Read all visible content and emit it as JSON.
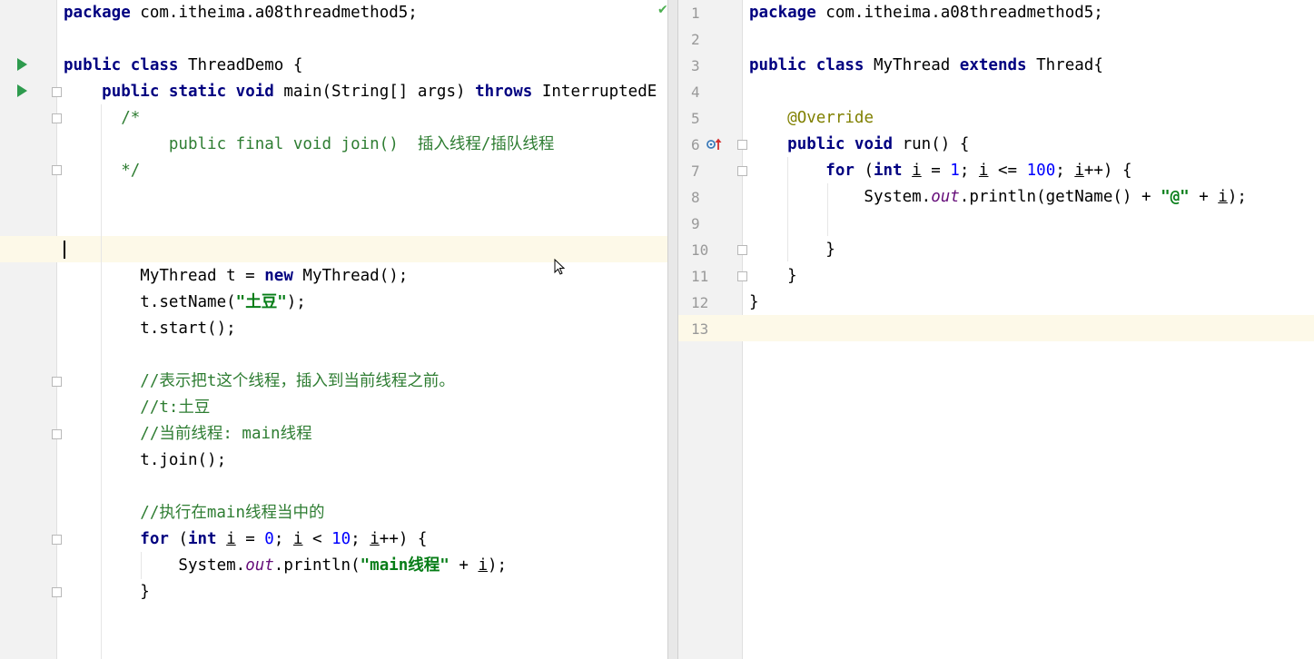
{
  "left_editor": {
    "lines": [
      {
        "parts": [
          {
            "t": "package",
            "c": "kw"
          },
          {
            "t": " com.itheima.a08threadmethod5;"
          }
        ]
      },
      {
        "parts": []
      },
      {
        "parts": [
          {
            "t": "public class",
            "c": "kw"
          },
          {
            "t": " ThreadDemo {"
          }
        ]
      },
      {
        "parts": [
          {
            "t": "    "
          },
          {
            "t": "public static void",
            "c": "kw"
          },
          {
            "t": " main(String[] args) "
          },
          {
            "t": "throws",
            "c": "kw"
          },
          {
            "t": " InterruptedE"
          }
        ]
      },
      {
        "parts": [
          {
            "t": "      /*",
            "c": "cmt"
          }
        ]
      },
      {
        "parts": [
          {
            "t": "           public final void join()  插入线程/插队线程",
            "c": "cmt"
          }
        ]
      },
      {
        "parts": [
          {
            "t": "      */",
            "c": "cmt"
          }
        ]
      },
      {
        "parts": []
      },
      {
        "parts": []
      },
      {
        "parts": []
      },
      {
        "parts": [
          {
            "t": "        MyThread t = "
          },
          {
            "t": "new",
            "c": "kw"
          },
          {
            "t": " MyThread();"
          }
        ]
      },
      {
        "parts": [
          {
            "t": "        t.setName("
          },
          {
            "t": "\"土豆\"",
            "c": "str"
          },
          {
            "t": ");"
          }
        ]
      },
      {
        "parts": [
          {
            "t": "        t.start();"
          }
        ]
      },
      {
        "parts": []
      },
      {
        "parts": [
          {
            "t": "        //表示把t这个线程，插入到当前线程之前。",
            "c": "cmt"
          }
        ]
      },
      {
        "parts": [
          {
            "t": "        //t:土豆",
            "c": "cmt"
          }
        ]
      },
      {
        "parts": [
          {
            "t": "        //当前线程: main线程",
            "c": "cmt"
          }
        ]
      },
      {
        "parts": [
          {
            "t": "        t.join();"
          }
        ]
      },
      {
        "parts": []
      },
      {
        "parts": [
          {
            "t": "        //执行在main线程当中的",
            "c": "cmt"
          }
        ]
      },
      {
        "parts": [
          {
            "t": "        "
          },
          {
            "t": "for",
            "c": "kw"
          },
          {
            "t": " ("
          },
          {
            "t": "int",
            "c": "kw"
          },
          {
            "t": " "
          },
          {
            "t": "i",
            "c": "ul"
          },
          {
            "t": " = "
          },
          {
            "t": "0",
            "c": "num"
          },
          {
            "t": "; "
          },
          {
            "t": "i",
            "c": "ul"
          },
          {
            "t": " < "
          },
          {
            "t": "10",
            "c": "num"
          },
          {
            "t": "; "
          },
          {
            "t": "i",
            "c": "ul"
          },
          {
            "t": "++) {"
          }
        ]
      },
      {
        "parts": [
          {
            "t": "            System."
          },
          {
            "t": "out",
            "c": "stat"
          },
          {
            "t": ".println("
          },
          {
            "t": "\"main线程\"",
            "c": "str"
          },
          {
            "t": " + "
          },
          {
            "t": "i",
            "c": "ul"
          },
          {
            "t": ");"
          }
        ]
      },
      {
        "parts": [
          {
            "t": "        }"
          }
        ]
      }
    ]
  },
  "right_editor": {
    "line_numbers": [
      "1",
      "2",
      "3",
      "4",
      "5",
      "6",
      "7",
      "8",
      "9",
      "10",
      "11",
      "12",
      "13"
    ],
    "lines": [
      {
        "parts": [
          {
            "t": "package",
            "c": "kw"
          },
          {
            "t": " com.itheima.a08threadmethod5;"
          }
        ]
      },
      {
        "parts": []
      },
      {
        "parts": [
          {
            "t": "public class",
            "c": "kw"
          },
          {
            "t": " MyThread "
          },
          {
            "t": "extends",
            "c": "kw"
          },
          {
            "t": " Thread{"
          }
        ]
      },
      {
        "parts": []
      },
      {
        "parts": [
          {
            "t": "    "
          },
          {
            "t": "@Override",
            "c": "ann"
          }
        ]
      },
      {
        "parts": [
          {
            "t": "    "
          },
          {
            "t": "public void",
            "c": "kw"
          },
          {
            "t": " run() {"
          }
        ]
      },
      {
        "parts": [
          {
            "t": "        "
          },
          {
            "t": "for",
            "c": "kw"
          },
          {
            "t": " ("
          },
          {
            "t": "int",
            "c": "kw"
          },
          {
            "t": " "
          },
          {
            "t": "i",
            "c": "ul"
          },
          {
            "t": " = "
          },
          {
            "t": "1",
            "c": "num"
          },
          {
            "t": "; "
          },
          {
            "t": "i",
            "c": "ul"
          },
          {
            "t": " <= "
          },
          {
            "t": "100",
            "c": "num"
          },
          {
            "t": "; "
          },
          {
            "t": "i",
            "c": "ul"
          },
          {
            "t": "++) {"
          }
        ]
      },
      {
        "parts": [
          {
            "t": "            System."
          },
          {
            "t": "out",
            "c": "stat"
          },
          {
            "t": ".println(getName() + "
          },
          {
            "t": "\"@\"",
            "c": "str"
          },
          {
            "t": " + "
          },
          {
            "t": "i",
            "c": "ul"
          },
          {
            "t": ");"
          }
        ]
      },
      {
        "parts": []
      },
      {
        "parts": [
          {
            "t": "        }"
          }
        ]
      },
      {
        "parts": [
          {
            "t": "    }"
          }
        ]
      },
      {
        "parts": [
          {
            "t": "}"
          }
        ]
      },
      {
        "parts": []
      }
    ]
  },
  "icons": {
    "run": "run-gutter-icon",
    "fold": "fold-marker-icon",
    "inspection_ok": "check-icon",
    "override": "override-marker-icon",
    "cursor": "mouse-pointer-icon"
  },
  "colors": {
    "keyword": "#000080",
    "number": "#0000ff",
    "string": "#067d17",
    "comment": "#2e7d32",
    "annotation": "#808000",
    "static_field": "#660e7a",
    "caret_line": "#fdf9e8",
    "run_icon": "#2e9b4e"
  }
}
